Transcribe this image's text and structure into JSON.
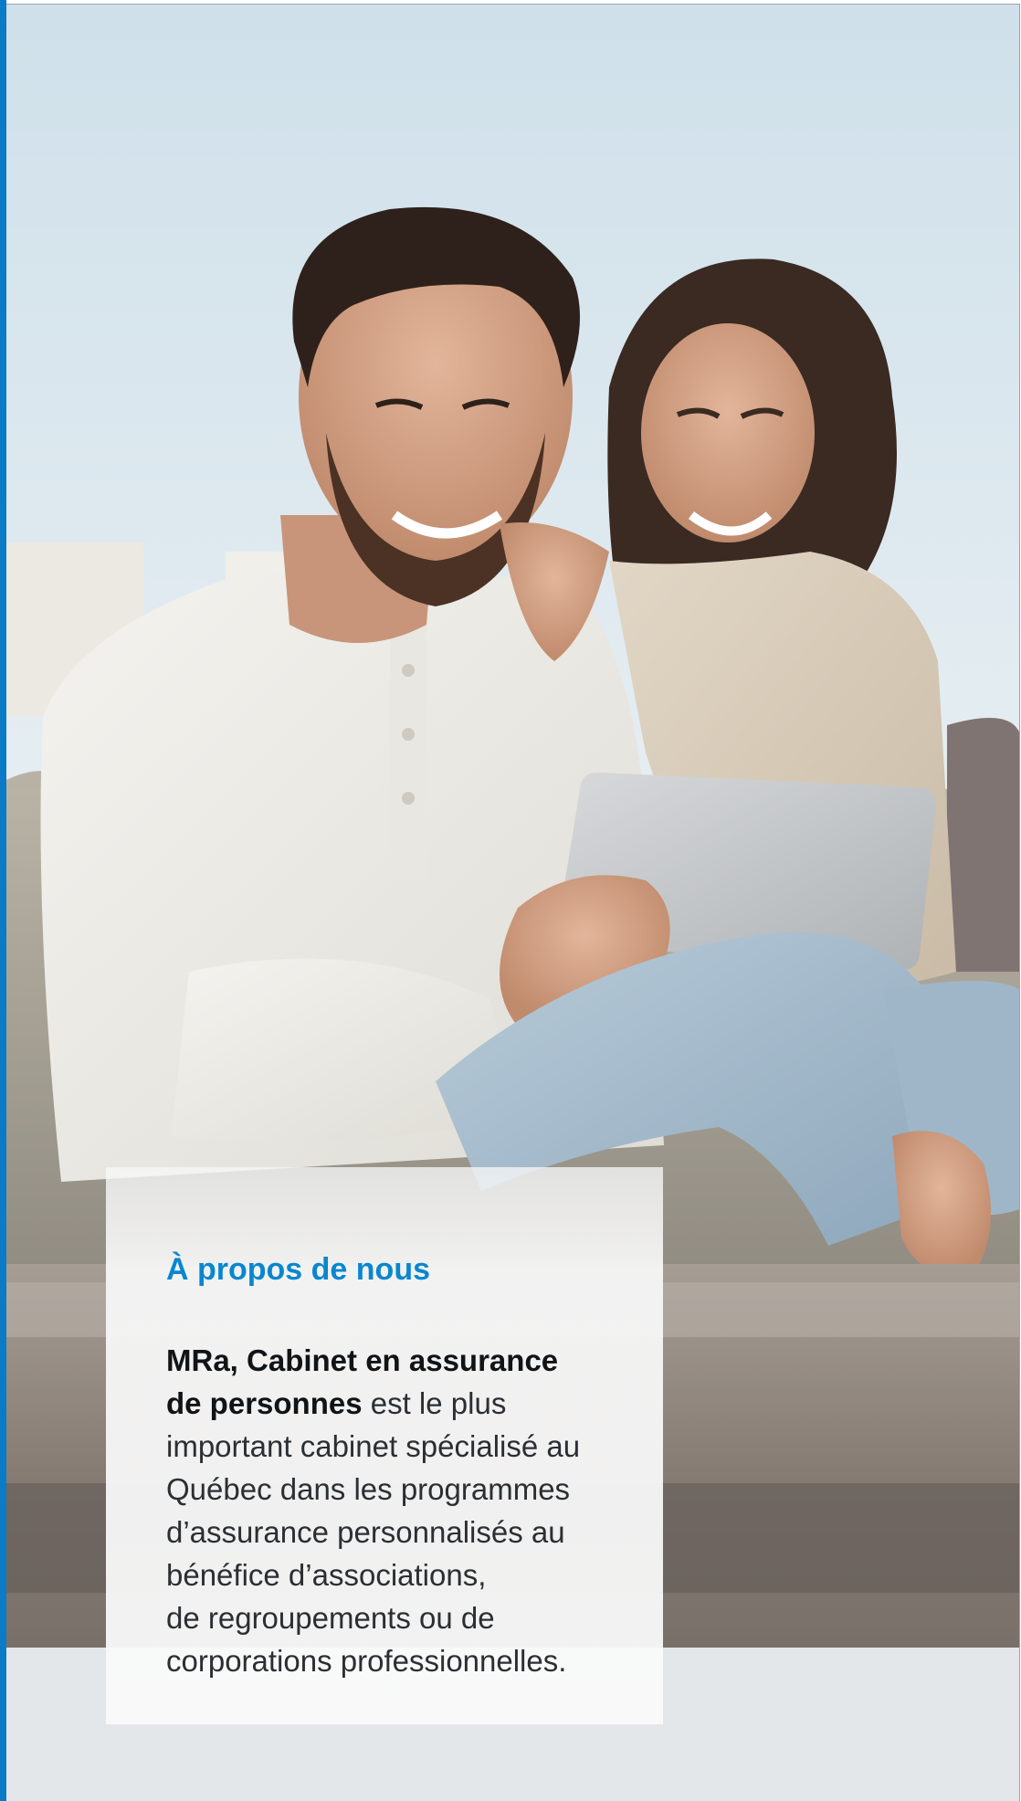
{
  "about": {
    "title": "À propos de nous",
    "body_lines": [
      {
        "bold": "MRa, Cabinet en assurance",
        "normal": ""
      },
      {
        "bold": "de personnes",
        "normal": " est le plus"
      },
      {
        "bold": "",
        "normal": "important cabinet spécialisé au"
      },
      {
        "bold": "",
        "normal": "Québec dans les programmes"
      },
      {
        "bold": "",
        "normal": "d’assurance personnalisés au"
      },
      {
        "bold": "",
        "normal": "bénéfice d’associations,"
      },
      {
        "bold": "",
        "normal": "de regroupements ou de"
      },
      {
        "bold": "",
        "normal": "corporations professionnelles."
      }
    ]
  },
  "colors": {
    "accent_blue": "#0a7bc4",
    "title_blue": "#0a86cf"
  },
  "photo": {
    "icon": "couple-with-tablet-photo"
  }
}
